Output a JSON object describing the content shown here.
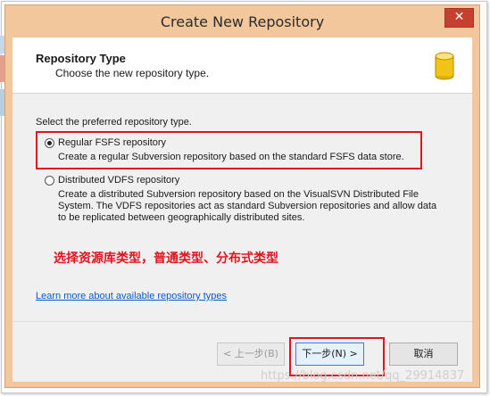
{
  "window": {
    "title": "Create New Repository",
    "close_glyph": "✕"
  },
  "header": {
    "title": "Repository Type",
    "subtitle": "Choose the new repository type.",
    "icon": "database-icon"
  },
  "prompt": "Select the preferred repository type.",
  "options": [
    {
      "label": "Regular FSFS repository",
      "description": "Create a regular Subversion repository based on the standard FSFS data store.",
      "selected": true
    },
    {
      "label": "Distributed VDFS repository",
      "description": "Create a distributed Subversion repository based on the VisualSVN Distributed File\nSystem. The VDFS repositories act as standard Subversion repositories and allow data\nto be replicated between geographically distributed sites.",
      "selected": false
    }
  ],
  "annotation": "选择资源库类型，普通类型、分布式类型",
  "learn_more_link": "Learn more about available repository types",
  "buttons": {
    "back": "< 上一步(B)",
    "next": "下一步(N) >",
    "cancel": "取消"
  },
  "watermark": "https://blog.csdn.net/qq_29914837",
  "colors": {
    "title_bar": "#f3c79c",
    "close_button": "#c7402f",
    "highlight": "#e0141e",
    "link": "#0a58c7"
  }
}
